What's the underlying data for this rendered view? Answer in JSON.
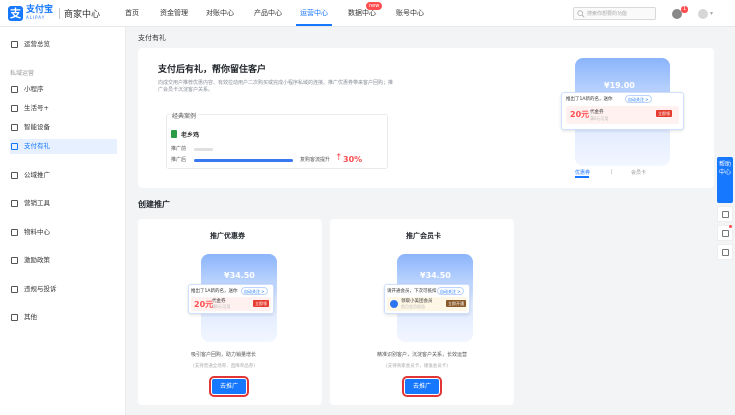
{
  "brand": {
    "logo_glyph": "支",
    "name": "支付宝",
    "sub": "ALIPAY",
    "portal": "商家中心"
  },
  "nav": {
    "items": [
      {
        "label": "首页"
      },
      {
        "label": "资金管理"
      },
      {
        "label": "对账中心"
      },
      {
        "label": "产品中心"
      },
      {
        "label": "运营中心"
      },
      {
        "label": "数据中心"
      },
      {
        "label": "账号中心"
      }
    ],
    "active": "运营中心",
    "data_badge": "new"
  },
  "search": {
    "placeholder": "搜索你想要的功能"
  },
  "header": {
    "bell_badge": "1"
  },
  "sidebar": {
    "overview": "运营总览",
    "group_label": "私域运营",
    "items": [
      {
        "label": "小程序"
      },
      {
        "label": "生活号+"
      },
      {
        "label": "智能设备"
      },
      {
        "label": "支付有礼"
      },
      {
        "label": "公域推广"
      },
      {
        "label": "营销工具"
      },
      {
        "label": "物料中心"
      },
      {
        "label": "激励政策"
      },
      {
        "label": "违规与投诉"
      },
      {
        "label": "其他"
      }
    ],
    "active": "支付有礼"
  },
  "breadcrumb": "支付有礼",
  "intro": {
    "title": "支付后有礼，帮你留住客户",
    "desc": "向成交用户推荐优惠内容、有效拉动用户二次购买或完成小程序私域的连接。推广优惠券带来客户回购；推广会员卡沉淀客户关系。",
    "case_label": "经典案例",
    "merchant": "老乡鸡",
    "before_label": "推广前",
    "after_label": "推广后",
    "lift_label": "复购客流提升",
    "lift_value": "30%",
    "before_ratio": 0.17,
    "after_ratio": 0.9
  },
  "preview": {
    "amount": "¥19.00",
    "popup_text": "推出了1A新的名，送你",
    "popup_pill": "自动关注 >",
    "coupon_value": "20元",
    "coupon_name": "代金券",
    "coupon_sub": "满0元可用",
    "coupon_btn": "立即领",
    "tabs": [
      "优惠券",
      "会员卡"
    ],
    "active_tab": "优惠券"
  },
  "create_section": {
    "title": "创建推广"
  },
  "coupon_card": {
    "title": "推广优惠券",
    "amount": "¥34.50",
    "popup_text": "推出了1A新的名，送你",
    "popup_pill": "自动关注 >",
    "coupon_value": "20元",
    "coupon_name": "代金券",
    "coupon_sub": "满0元可用",
    "coupon_btn": "立即领",
    "desc": "吸引客户回购，助力销量增长",
    "note": "(支持普通全场券、直降单品券)",
    "button": "去推广"
  },
  "member_card": {
    "title": "推广会员卡",
    "amount": "¥34.50",
    "popup_text": "请开通会员，下次可抵扣",
    "popup_pill": "自动关注 >",
    "member_name": "领取小美团会员",
    "member_sub": "首月会员权益",
    "member_btn": "立即开通",
    "desc": "精准识别客户，沉淀客户关系，长效运营",
    "note": "(支持商家会员卡，储值会员卡)",
    "button": "去推广"
  },
  "float": {
    "help": "帮助中心"
  },
  "colors": {
    "primary": "#1677ff",
    "danger": "#ff4d4f",
    "highlight_border": "#e23636"
  }
}
